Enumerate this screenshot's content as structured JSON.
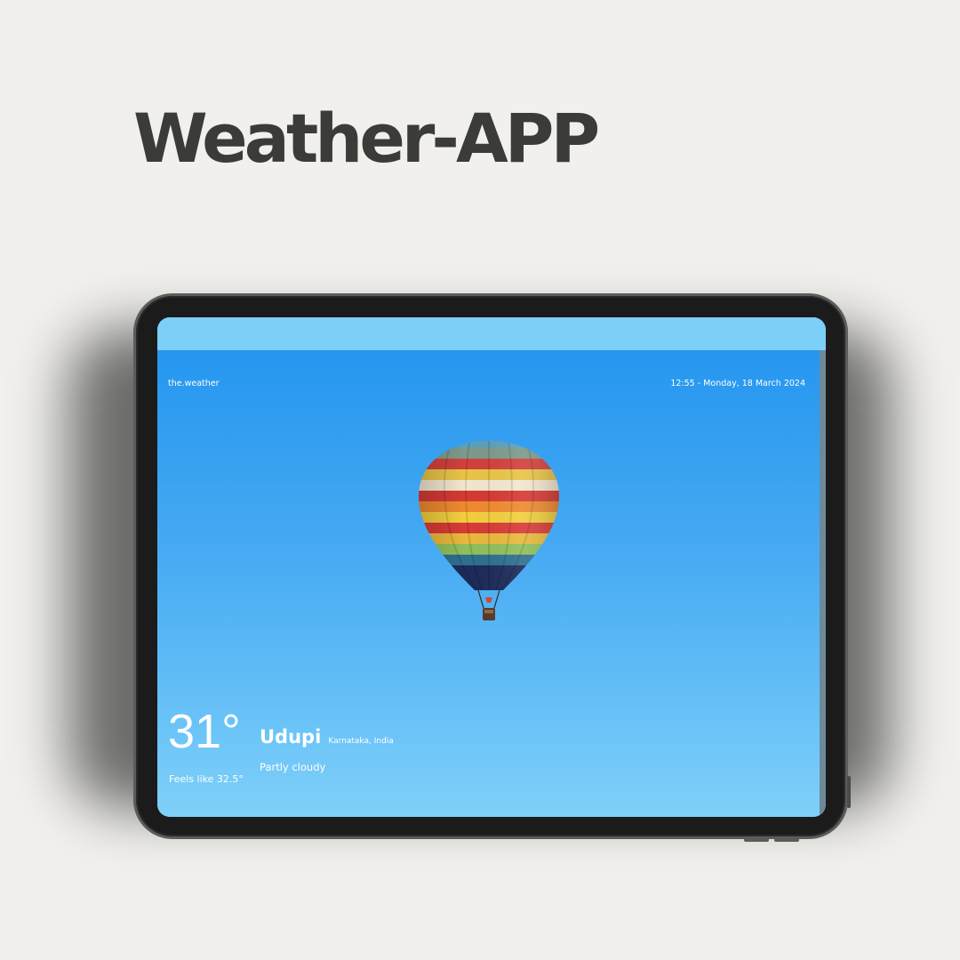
{
  "heading": "Weather-APP",
  "app": {
    "brand": "the.weather",
    "datetime": "12:55 - Monday, 18 March 2024",
    "temperature": "31°",
    "feels_like": "Feels like 32.5°",
    "city": "Udupi",
    "region": "Karnataka, India",
    "condition": "Partly cloudy",
    "illustration_icon": "hot-air-balloon"
  },
  "colors": {
    "page_background": "#f1f0ec",
    "heading_text": "#3b3b37",
    "sky_top": "#2596ef",
    "sky_bottom": "#7fd0f9",
    "device_frame": "#1b1b1b"
  }
}
